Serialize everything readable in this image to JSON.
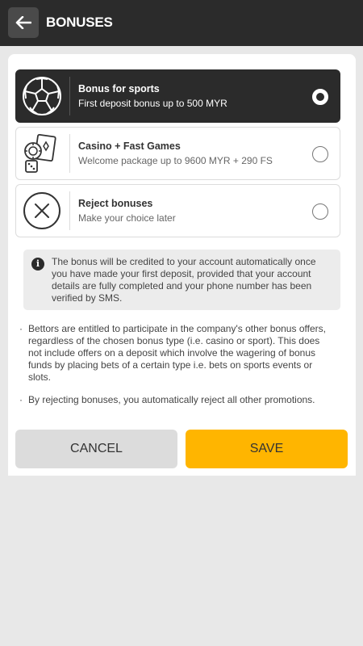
{
  "header": {
    "title": "BONUSES",
    "back_icon": "arrow-left-icon"
  },
  "options": [
    {
      "title": "Bonus for sports",
      "subtitle": "First deposit bonus up to 500 MYR",
      "icon": "soccer-ball-icon",
      "selected": true
    },
    {
      "title": "Casino + Fast Games",
      "subtitle": "Welcome package up to 9600 MYR + 290 FS",
      "icon": "casino-chips-cards-icon",
      "selected": false
    },
    {
      "title": "Reject bonuses",
      "subtitle": "Make your choice later",
      "icon": "cross-circle-icon",
      "selected": false
    }
  ],
  "info": {
    "icon_glyph": "i",
    "text": "The bonus will be credited to your account automatically once you have made your first deposit, provided that your account details are fully completed and your phone number has been verified by SMS."
  },
  "notes": [
    "Bettors are entitled to participate in the company's other bonus offers, regardless of the chosen bonus type (i.e. casino or sport). This does not include offers on a deposit which involve the wagering of bonus funds by placing bets of a certain type i.e. bets on sports events or slots.",
    "By rejecting bonuses, you automatically reject all other promotions."
  ],
  "bullet_glyph": "·",
  "actions": {
    "cancel_label": "CANCEL",
    "save_label": "SAVE"
  },
  "colors": {
    "header_bg": "#2b2b2b",
    "selected_bg": "#2b2b2b",
    "save_bg": "#ffb500",
    "cancel_bg": "#dcdcdc"
  }
}
